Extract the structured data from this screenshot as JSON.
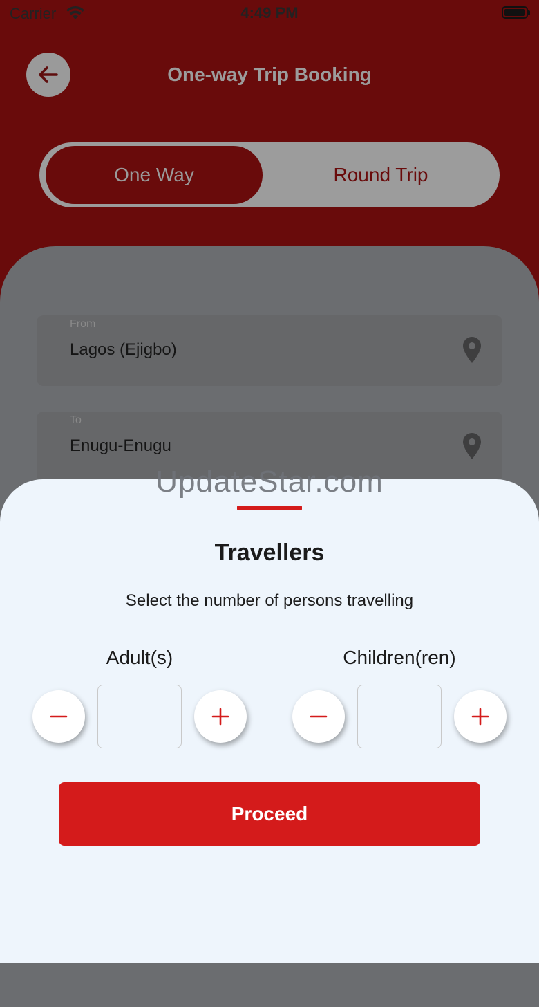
{
  "status_bar": {
    "carrier": "Carrier",
    "time": "4:49 PM"
  },
  "header": {
    "title": "One-way Trip Booking",
    "back_icon": "arrow-left-icon"
  },
  "trip_toggle": {
    "options": [
      {
        "label": "One Way",
        "selected": true
      },
      {
        "label": "Round Trip",
        "selected": false
      }
    ]
  },
  "form": {
    "from": {
      "label": "From",
      "value": "Lagos (Ejigbo)",
      "icon": "location-pin-icon"
    },
    "to": {
      "label": "To",
      "value": "Enugu-Enugu",
      "icon": "location-pin-icon"
    }
  },
  "watermark": "UpdateStar.com",
  "travellers_sheet": {
    "title": "Travellers",
    "subtitle": "Select the number of persons travelling",
    "adults": {
      "label": "Adult(s)",
      "value": ""
    },
    "children": {
      "label": "Children(ren)",
      "value": ""
    },
    "proceed_label": "Proceed"
  },
  "colors": {
    "brand_red": "#d41b1b",
    "overlay_red": "#690b0b",
    "sheet_bg": "#eef5fc"
  }
}
